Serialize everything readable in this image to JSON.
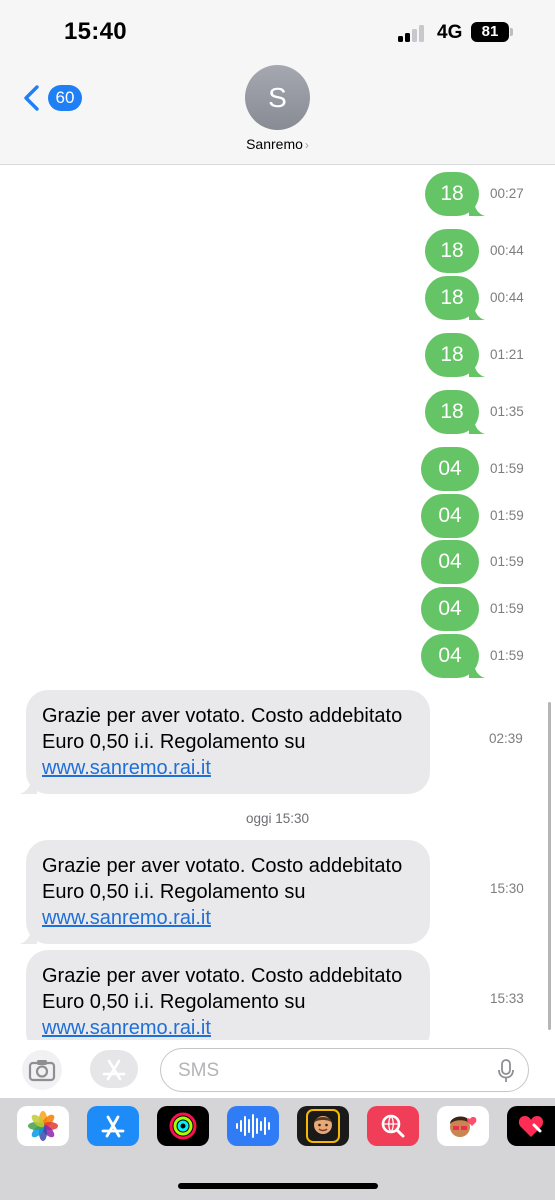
{
  "status": {
    "time": "15:40",
    "network": "4G",
    "battery": "81"
  },
  "header": {
    "back_count": "60",
    "avatar_initial": "S",
    "contact_name": "Sanremo"
  },
  "messages_sent": [
    {
      "text": "18",
      "time": "00:27"
    },
    {
      "text": "18",
      "time": "00:44"
    },
    {
      "text": "18",
      "time": "00:44"
    },
    {
      "text": "18",
      "time": "01:21"
    },
    {
      "text": "18",
      "time": "01:35"
    },
    {
      "text": "04",
      "time": "01:59"
    },
    {
      "text": "04",
      "time": "01:59"
    },
    {
      "text": "04",
      "time": "01:59"
    },
    {
      "text": "04",
      "time": "01:59"
    },
    {
      "text": "04",
      "time": "01:59"
    }
  ],
  "messages_received": [
    {
      "text": "Grazie per aver votato. Costo addebitato Euro 0,50 i.i. Regolamento su",
      "link": "www.sanremo.rai.it",
      "time": "02:39"
    },
    {
      "text": "Grazie per aver votato. Costo addebitato Euro 0,50 i.i. Regolamento su",
      "link": "www.sanremo.rai.it",
      "time": "15:30"
    },
    {
      "text": "Grazie per aver votato. Costo addebitato Euro 0,50 i.i. Regolamento su",
      "link": "www.sanremo.rai.it",
      "time": "15:33"
    }
  ],
  "day_separator": {
    "day": "oggi",
    "time": "15:30"
  },
  "composer": {
    "placeholder": "SMS"
  },
  "apps": [
    "photos-icon",
    "app-store-icon",
    "fitness-icon",
    "voice-memos-icon",
    "memoji-icon",
    "image-search-icon",
    "memoji-stickers-icon",
    "digital-touch-icon"
  ],
  "colors": {
    "sent_bubble": "#65c466",
    "received_bubble": "#e9e9eb",
    "link": "#1f6fd8",
    "badge": "#1f7ff5"
  }
}
